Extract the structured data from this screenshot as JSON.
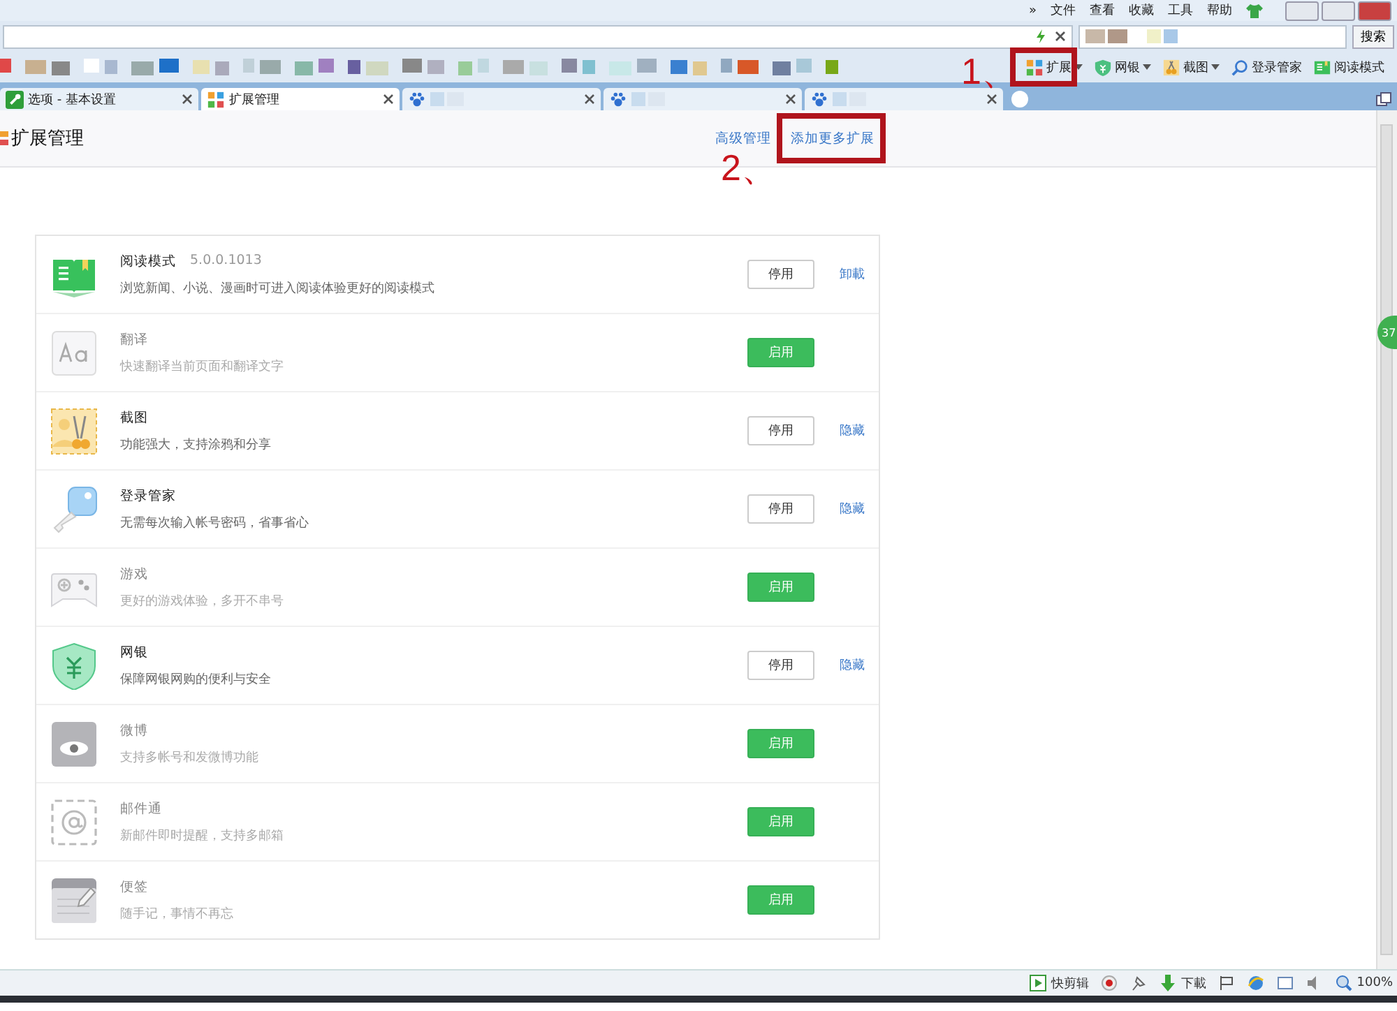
{
  "menu_bar": {
    "chevron": "»",
    "items": [
      "文件",
      "查看",
      "收藏",
      "工具",
      "帮助"
    ]
  },
  "address_bar": {
    "search_button": "搜索"
  },
  "toolbar": [
    {
      "kind": "grid",
      "label": "扩展",
      "dropdown": true,
      "annotation": "1、"
    },
    {
      "kind": "shield",
      "label": "网银",
      "dropdown": true
    },
    {
      "kind": "scissors",
      "label": "截图",
      "dropdown": true
    },
    {
      "kind": "search",
      "label": "登录管家",
      "dropdown": false
    },
    {
      "kind": "book",
      "label": "阅读模式",
      "dropdown": false
    }
  ],
  "tabs": [
    {
      "kind": "wrench",
      "title": "选项 - 基本设置",
      "selected": false
    },
    {
      "kind": "grid",
      "title": "扩展管理",
      "selected": true
    },
    {
      "kind": "paw",
      "selected": false
    },
    {
      "kind": "paw",
      "selected": false
    },
    {
      "kind": "paw",
      "selected": false
    }
  ],
  "page": {
    "title": "扩展管理",
    "links": [
      {
        "label": "高级管理"
      },
      {
        "label": "添加更多扩展",
        "annotation": "2、"
      }
    ],
    "side_badge": "37"
  },
  "extensions": [
    {
      "kind": "book",
      "name": "阅读模式",
      "version": "5.0.0.1013",
      "description": "浏览新闻、小说、漫画时可进入阅读体验更好的阅读模式",
      "enabled": true,
      "button": "停用",
      "link": "卸載"
    },
    {
      "kind": "translate",
      "name": "翻译",
      "description": "快速翻译当前页面和翻译文字",
      "enabled": false,
      "button": "启用"
    },
    {
      "kind": "scissors",
      "name": "截图",
      "description": "功能强大，支持涂鸦和分享",
      "enabled": true,
      "button": "停用",
      "link": "隐藏"
    },
    {
      "kind": "key",
      "name": "登录管家",
      "description": "无需每次输入帐号密码，省事省心",
      "enabled": true,
      "button": "停用",
      "link": "隐藏"
    },
    {
      "kind": "gamepad",
      "name": "游戏",
      "description": "更好的游戏体验，多开不串号",
      "enabled": false,
      "button": "启用"
    },
    {
      "kind": "shield",
      "name": "网银",
      "description": "保障网银网购的便利与安全",
      "enabled": true,
      "button": "停用",
      "link": "隐藏"
    },
    {
      "kind": "eye",
      "name": "微博",
      "description": "支持多帐号和发微博功能",
      "enabled": false,
      "button": "启用"
    },
    {
      "kind": "mail",
      "name": "邮件通",
      "description": "新邮件即时提醒，支持多邮箱",
      "enabled": false,
      "button": "启用"
    },
    {
      "kind": "note",
      "name": "便签",
      "description": "随手记，事情不再忘",
      "enabled": false,
      "button": "启用"
    }
  ],
  "status_bar": [
    {
      "kind": "play",
      "label": "快剪辑"
    },
    {
      "kind": "record"
    },
    {
      "kind": "pin"
    },
    {
      "kind": "download",
      "label": "下載"
    },
    {
      "kind": "flag"
    },
    {
      "kind": "ie"
    },
    {
      "kind": "window"
    },
    {
      "kind": "speaker"
    },
    {
      "kind": "zoom",
      "label": "100%"
    }
  ]
}
